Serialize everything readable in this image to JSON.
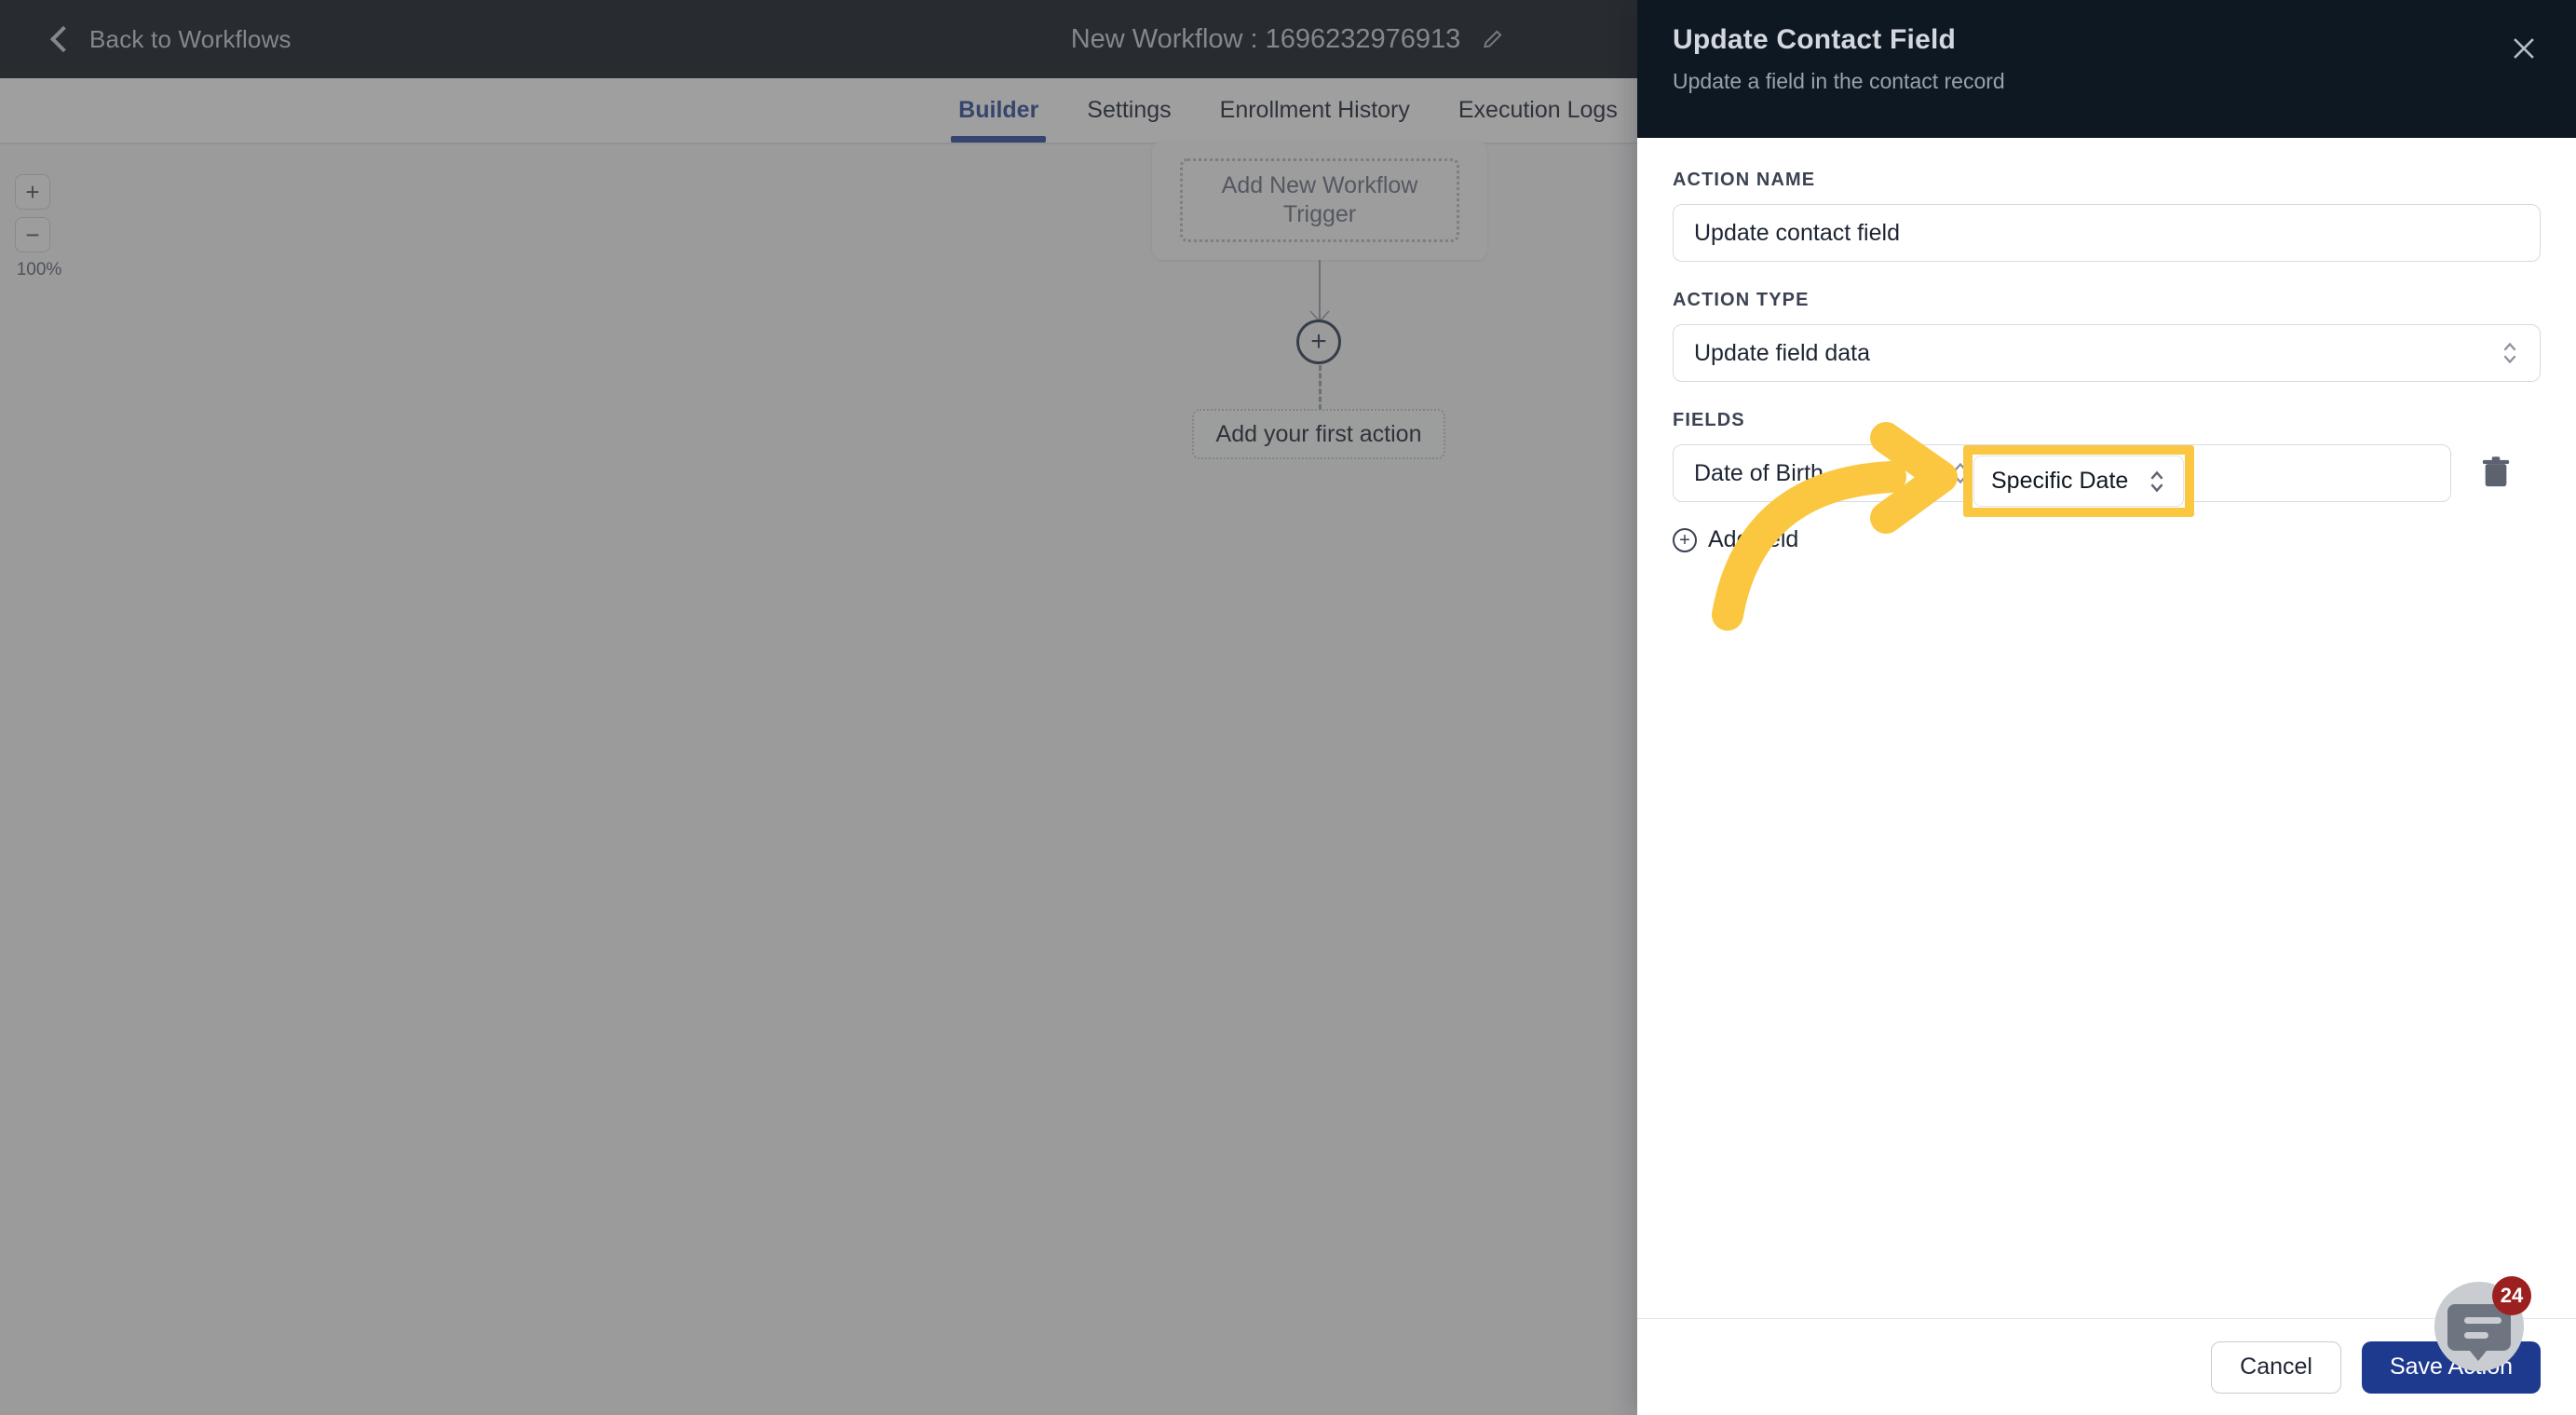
{
  "topbar": {
    "back_label": "Back to Workflows",
    "back_icon": "chevron-left-icon",
    "workflow_title": "New Workflow : 1696232976913",
    "edit_icon": "pencil-icon"
  },
  "tabs": [
    {
      "label": "Builder",
      "active": true
    },
    {
      "label": "Settings",
      "active": false
    },
    {
      "label": "Enrollment History",
      "active": false
    },
    {
      "label": "Execution Logs",
      "active": false
    }
  ],
  "canvas": {
    "zoom": {
      "zoom_in_label": "+",
      "zoom_out_label": "−",
      "level": "100%"
    },
    "trigger_card_label": "Add New Workflow Trigger",
    "add_node_icon": "plus-circle-icon",
    "first_action_label": "Add your first action"
  },
  "panel": {
    "title": "Update Contact Field",
    "subtitle": "Update a field in the contact record",
    "close_icon": "close-icon",
    "action_name": {
      "label": "ACTION NAME",
      "value": "Update contact field",
      "placeholder": "Action name"
    },
    "action_type": {
      "label": "ACTION TYPE",
      "value": "Update field data",
      "chevron_icon": "chevron-up-down-icon"
    },
    "fields": {
      "label": "FIELDS",
      "rows": [
        {
          "field_name": "Date of Birth",
          "field_name_chevron": "chevron-up-down-icon",
          "field_value": "Specific Date",
          "field_value_chevron": "chevron-up-down-icon",
          "delete_icon": "trash-icon"
        }
      ],
      "add_field_label": "Add field",
      "add_field_icon": "plus-circle-icon"
    },
    "footer": {
      "cancel_label": "Cancel",
      "save_label": "Save Action"
    }
  },
  "chat_widget": {
    "icon": "chat-bubble-icon",
    "badge_count": "24"
  },
  "annotation": {
    "highlight_color": "#FBC740",
    "arrow_icon": "curved-arrow-right-icon",
    "target": "Specific Date"
  },
  "colors": {
    "topbar_bg": "#111822",
    "panel_header_bg": "#0E1823",
    "accent_blue": "#2B4B9B",
    "save_button_bg": "#1E3A8F",
    "badge_red": "#9C2020",
    "highlight_yellow": "#FBC740"
  }
}
